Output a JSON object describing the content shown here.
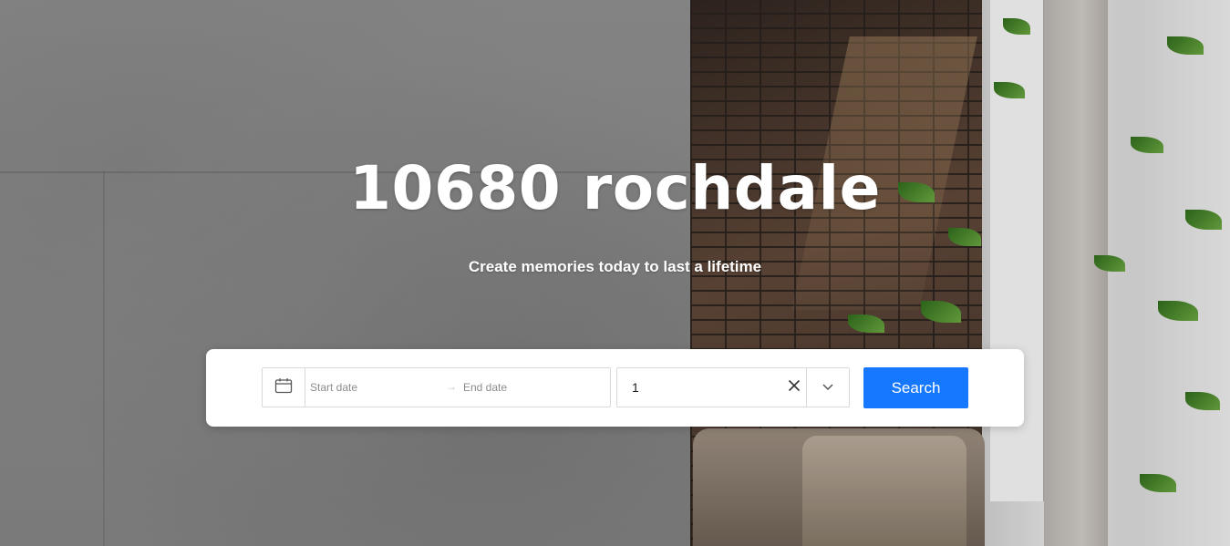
{
  "hero": {
    "title": "10680 rochdale",
    "subtitle": "Create memories today to last a lifetime"
  },
  "search": {
    "date_icon": "calendar-icon",
    "start_placeholder": "Start date",
    "separator": "→",
    "end_placeholder": "End date",
    "guests_value": "1",
    "clear_icon": "close-icon",
    "dropdown_icon": "chevron-down-icon",
    "button_label": "Search",
    "button_color": "#1677ff"
  }
}
